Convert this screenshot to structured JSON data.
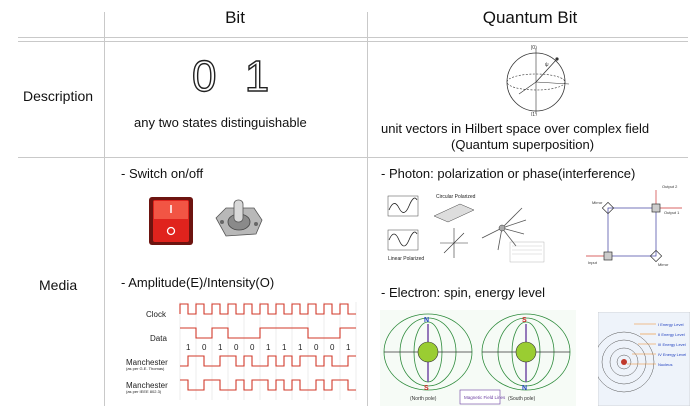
{
  "header": {
    "col1": "Bit",
    "col2": "Quantum Bit"
  },
  "rows": {
    "description": "Description",
    "media": "Media"
  },
  "bit": {
    "digits": "0 1",
    "description": "any two states distinguishable",
    "media_item1": "- Switch on/off",
    "media_item2": "- Amplitude(E)/Intensity(O)",
    "timing": {
      "clock_label": "Clock",
      "data_label": "Data",
      "manchester1_label": "Manchester",
      "manchester1_note": "(as per G.E. Thomas)",
      "manchester2_label": "Manchester",
      "manchester2_note": "(as per IEEE 802.3)",
      "bits": [
        "1",
        "0",
        "1",
        "0",
        "0",
        "1",
        "1",
        "1",
        "0",
        "0",
        "1"
      ]
    }
  },
  "qubit": {
    "description_line1": "unit vectors in Hilbert space over complex field",
    "description_line2": "(Quantum superposition)",
    "media_item1": "- Photon: polarization or phase(interference)",
    "media_item2": "- Electron: spin, energy level",
    "photon": {
      "circular": "Circular Polarized",
      "linear": "Linear Polarized",
      "mirror": "Mirror",
      "output1": "Output 1",
      "output2": "Output 2",
      "input": "Input"
    },
    "electron": {
      "north": "N",
      "south": "S",
      "north_pole": "(North pole)",
      "south_pole": "(South pole)",
      "field_lines": "Magnetic Field Lines",
      "levels": [
        "I  Energy Level",
        "II  Energy Level",
        "III  Energy Level",
        "IV  Energy Level",
        "Nucleus"
      ]
    }
  },
  "colors": {
    "grid": "#c9c9c9",
    "switch_red": "#e0231d",
    "level_orange": "#f08a24"
  }
}
